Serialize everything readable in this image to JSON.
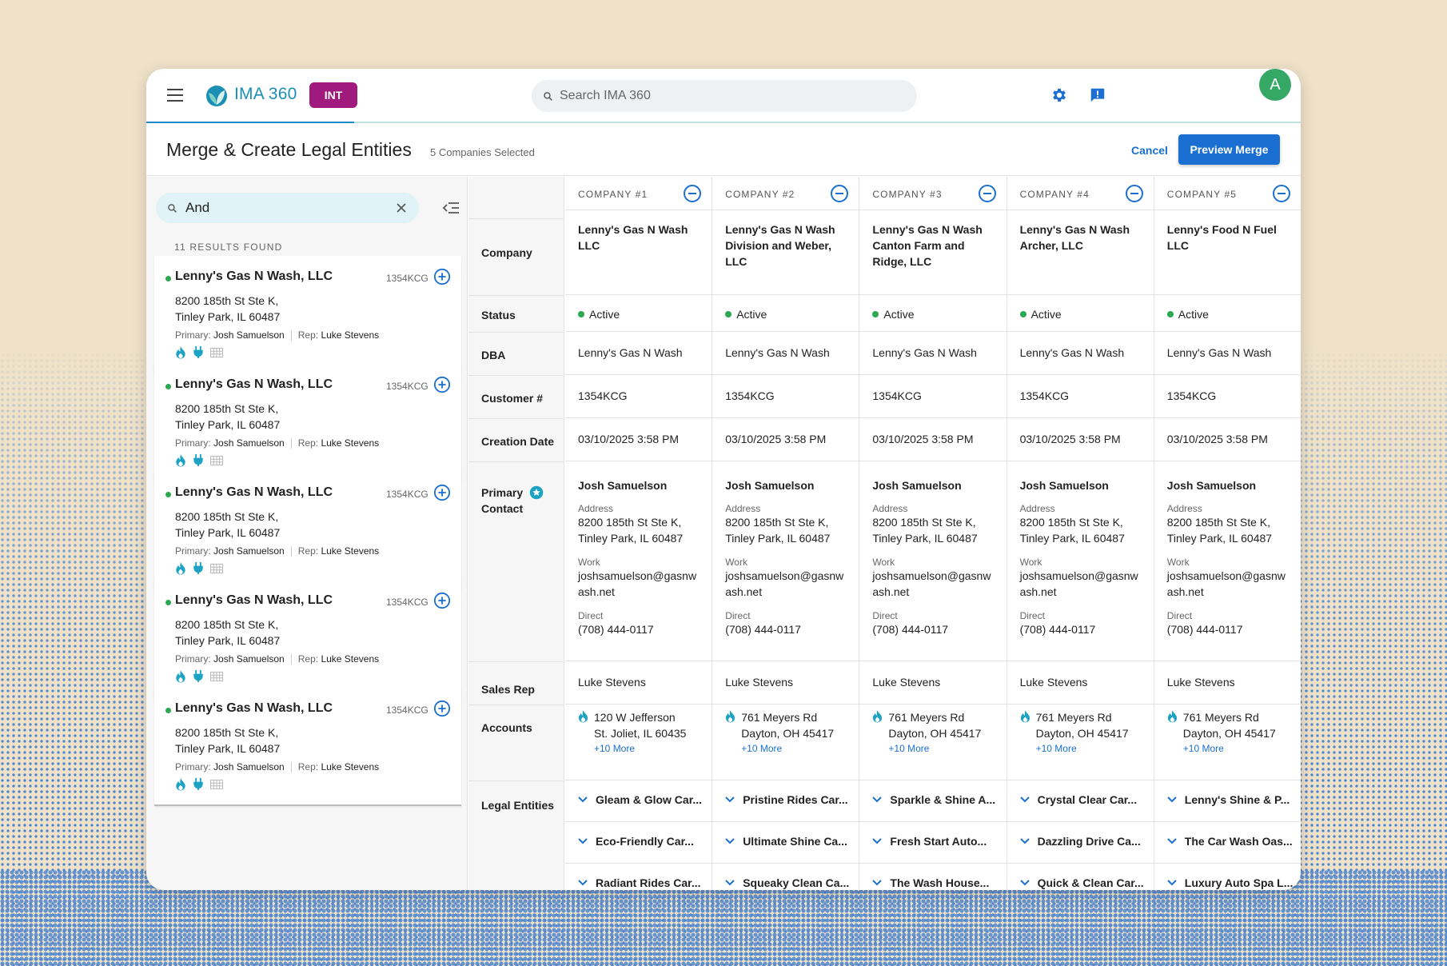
{
  "app": {
    "brand": "IMA 360",
    "env_badge": "INT",
    "search_placeholder": "Search IMA 360",
    "avatar_initial": "A"
  },
  "colors": {
    "accent": "#1b6fd2",
    "brand": "#1a8fb5",
    "badge": "#a01a7d",
    "active": "#2aa84f",
    "avatar": "#35a866"
  },
  "page": {
    "title": "Merge & Create Legal Entities",
    "selected_count": "5 Companies Selected",
    "cancel": "Cancel",
    "preview": "Preview Merge"
  },
  "search_panel": {
    "query": "And",
    "results_count": "11 RESULTS FOUND",
    "results": [
      {
        "name": "Lenny's Gas N Wash, LLC",
        "code": "1354KCG",
        "address1": "8200 185th St Ste K,",
        "address2": "Tinley Park, IL 60487",
        "primary_label": "Primary:",
        "primary": "Josh Samuelson",
        "rep_label": "Rep:",
        "rep": "Luke Stevens"
      },
      {
        "name": "Lenny's Gas N Wash, LLC",
        "code": "1354KCG",
        "address1": "8200 185th St Ste K,",
        "address2": "Tinley Park, IL 60487",
        "primary_label": "Primary:",
        "primary": "Josh Samuelson",
        "rep_label": "Rep:",
        "rep": "Luke Stevens"
      },
      {
        "name": "Lenny's Gas N Wash, LLC",
        "code": "1354KCG",
        "address1": "8200 185th St Ste K,",
        "address2": "Tinley Park, IL 60487",
        "primary_label": "Primary:",
        "primary": "Josh Samuelson",
        "rep_label": "Rep:",
        "rep": "Luke Stevens"
      },
      {
        "name": "Lenny's Gas N Wash, LLC",
        "code": "1354KCG",
        "address1": "8200 185th St Ste K,",
        "address2": "Tinley Park, IL 60487",
        "primary_label": "Primary:",
        "primary": "Josh Samuelson",
        "rep_label": "Rep:",
        "rep": "Luke Stevens"
      },
      {
        "name": "Lenny's Gas N Wash, LLC",
        "code": "1354KCG",
        "address1": "8200 185th St Ste K,",
        "address2": "Tinley Park, IL 60487",
        "primary_label": "Primary:",
        "primary": "Josh Samuelson",
        "rep_label": "Rep:",
        "rep": "Luke Stevens"
      }
    ]
  },
  "row_labels": {
    "company": "Company",
    "status": "Status",
    "dba": "DBA",
    "customer": "Customer #",
    "creation": "Creation Date",
    "primary_contact_1": "Primary",
    "primary_contact_2": "Contact",
    "sales_rep": "Sales Rep",
    "accounts": "Accounts",
    "legal_entities": "Legal Entities"
  },
  "contact_field_labels": {
    "address": "Address",
    "work": "Work",
    "direct": "Direct"
  },
  "companies": [
    {
      "header": "COMPANY #1",
      "name1": "Lenny's Gas N Wash",
      "name2": "LLC",
      "name3": "",
      "status": "Active",
      "dba": "Lenny's Gas N Wash",
      "customer": "1354KCG",
      "created": "03/10/2025 3:58 PM",
      "contact_name": "Josh Samuelson",
      "contact_addr1": "8200 185th St Ste K,",
      "contact_addr2": "Tinley Park, IL 60487",
      "email1": "joshsamuelson@gasnw",
      "email2": "ash.net",
      "phone": "(708) 444-0117",
      "sales_rep": "Luke Stevens",
      "acct1": "120 W Jefferson",
      "acct2": "St. Joliet, IL 60435",
      "acct_more": "+10 More",
      "le1": "Gleam & Glow Car...",
      "le2": "Eco-Friendly Car...",
      "le3": "Radiant Rides Car..."
    },
    {
      "header": "COMPANY #2",
      "name1": "Lenny's Gas N Wash",
      "name2": "Division and Weber,",
      "name3": "LLC",
      "status": "Active",
      "dba": "Lenny's Gas N Wash",
      "customer": "1354KCG",
      "created": "03/10/2025 3:58 PM",
      "contact_name": "Josh Samuelson",
      "contact_addr1": "8200 185th St Ste K,",
      "contact_addr2": "Tinley Park, IL 60487",
      "email1": "joshsamuelson@gasnw",
      "email2": "ash.net",
      "phone": "(708) 444-0117",
      "sales_rep": "Luke Stevens",
      "acct1": "761 Meyers Rd",
      "acct2": "Dayton, OH 45417",
      "acct_more": "+10 More",
      "le1": "Pristine Rides Car...",
      "le2": "Ultimate Shine Ca...",
      "le3": "Squeaky Clean Ca..."
    },
    {
      "header": "COMPANY #3",
      "name1": "Lenny's Gas N Wash",
      "name2": "Canton Farm and",
      "name3": "Ridge, LLC",
      "status": "Active",
      "dba": "Lenny's Gas N Wash",
      "customer": "1354KCG",
      "created": "03/10/2025 3:58 PM",
      "contact_name": "Josh Samuelson",
      "contact_addr1": "8200 185th St Ste K,",
      "contact_addr2": "Tinley Park, IL 60487",
      "email1": "joshsamuelson@gasnw",
      "email2": "ash.net",
      "phone": "(708) 444-0117",
      "sales_rep": "Luke Stevens",
      "acct1": "761 Meyers Rd",
      "acct2": "Dayton, OH 45417",
      "acct_more": "+10 More",
      "le1": "Sparkle & Shine A...",
      "le2": "Fresh Start Auto...",
      "le3": "The Wash House..."
    },
    {
      "header": "COMPANY #4",
      "name1": "Lenny's Gas N Wash",
      "name2": "Archer, LLC",
      "name3": "",
      "status": "Active",
      "dba": "Lenny's Gas N Wash",
      "customer": "1354KCG",
      "created": "03/10/2025 3:58 PM",
      "contact_name": "Josh Samuelson",
      "contact_addr1": "8200 185th St Ste K,",
      "contact_addr2": "Tinley Park, IL 60487",
      "email1": "joshsamuelson@gasnw",
      "email2": "ash.net",
      "phone": "(708) 444-0117",
      "sales_rep": "Luke Stevens",
      "acct1": "761 Meyers Rd",
      "acct2": "Dayton, OH 45417",
      "acct_more": "+10 More",
      "le1": "Crystal Clear Car...",
      "le2": "Dazzling Drive Ca...",
      "le3": "Quick & Clean Car..."
    },
    {
      "header": "COMPANY #5",
      "name1": "Lenny's Food N Fuel",
      "name2": "LLC",
      "name3": "",
      "status": "Active",
      "dba": "Lenny's Gas N Wash",
      "customer": "1354KCG",
      "created": "03/10/2025 3:58 PM",
      "contact_name": "Josh Samuelson",
      "contact_addr1": "8200 185th St Ste K,",
      "contact_addr2": "Tinley Park, IL 60487",
      "email1": "joshsamuelson@gasnw",
      "email2": "ash.net",
      "phone": "(708) 444-0117",
      "sales_rep": "Luke Stevens",
      "acct1": "761 Meyers Rd",
      "acct2": "Dayton, OH 45417",
      "acct_more": "+10 More",
      "le1": "Lenny's Shine & P...",
      "le2": "The Car Wash Oas...",
      "le3": "Luxury Auto Spa L..."
    }
  ]
}
